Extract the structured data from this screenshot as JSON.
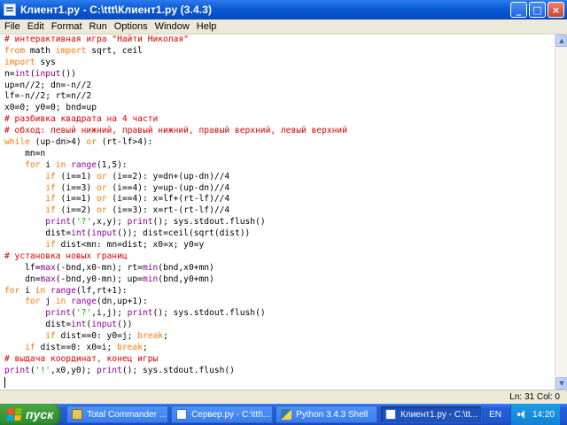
{
  "window": {
    "title": "Клиент1.py - C:\\ttt\\Клиент1.py (3.4.3)",
    "controls": {
      "minimize": "_",
      "maximize": "□",
      "close": "×"
    }
  },
  "menu": [
    "File",
    "Edit",
    "Format",
    "Run",
    "Options",
    "Window",
    "Help"
  ],
  "code_lines": [
    [
      {
        "t": "com",
        "s": "# интерактивная игра \"Найти Николая\""
      }
    ],
    [
      {
        "t": "kw",
        "s": "from"
      },
      {
        "t": "def",
        "s": " math "
      },
      {
        "t": "kw",
        "s": "import"
      },
      {
        "t": "def",
        "s": " sqrt, ceil"
      }
    ],
    [
      {
        "t": "kw",
        "s": "import"
      },
      {
        "t": "def",
        "s": " sys"
      }
    ],
    [
      {
        "t": "def",
        "s": "n="
      },
      {
        "t": "bi",
        "s": "int"
      },
      {
        "t": "def",
        "s": "("
      },
      {
        "t": "bi",
        "s": "input"
      },
      {
        "t": "def",
        "s": "())"
      }
    ],
    [
      {
        "t": "def",
        "s": "up=n//2; dn=-n//2"
      }
    ],
    [
      {
        "t": "def",
        "s": "lf=-n//2; rt=n//2"
      }
    ],
    [
      {
        "t": "def",
        "s": "x0=0; y0=0; bnd=up"
      }
    ],
    [
      {
        "t": "com",
        "s": "# разбивка квадрата на 4 части"
      }
    ],
    [
      {
        "t": "com",
        "s": "# обход: левый нижний, правый нижний, правый верхний, левый верхний"
      }
    ],
    [
      {
        "t": "kw",
        "s": "while"
      },
      {
        "t": "def",
        "s": " (up-dn>4) "
      },
      {
        "t": "kw",
        "s": "or"
      },
      {
        "t": "def",
        "s": " (rt-lf>4):"
      }
    ],
    [
      {
        "t": "def",
        "s": "    mn=n"
      }
    ],
    [
      {
        "t": "def",
        "s": "    "
      },
      {
        "t": "kw",
        "s": "for"
      },
      {
        "t": "def",
        "s": " i "
      },
      {
        "t": "kw",
        "s": "in"
      },
      {
        "t": "def",
        "s": " "
      },
      {
        "t": "bi",
        "s": "range"
      },
      {
        "t": "def",
        "s": "(1,5):"
      }
    ],
    [
      {
        "t": "def",
        "s": "        "
      },
      {
        "t": "kw",
        "s": "if"
      },
      {
        "t": "def",
        "s": " (i==1) "
      },
      {
        "t": "kw",
        "s": "or"
      },
      {
        "t": "def",
        "s": " (i==2): y=dn+(up-dn)//4"
      }
    ],
    [
      {
        "t": "def",
        "s": "        "
      },
      {
        "t": "kw",
        "s": "if"
      },
      {
        "t": "def",
        "s": " (i==3) "
      },
      {
        "t": "kw",
        "s": "or"
      },
      {
        "t": "def",
        "s": " (i==4): y=up-(up-dn)//4"
      }
    ],
    [
      {
        "t": "def",
        "s": "        "
      },
      {
        "t": "kw",
        "s": "if"
      },
      {
        "t": "def",
        "s": " (i==1) "
      },
      {
        "t": "kw",
        "s": "or"
      },
      {
        "t": "def",
        "s": " (i==4): x=lf+(rt-lf)//4"
      }
    ],
    [
      {
        "t": "def",
        "s": "        "
      },
      {
        "t": "kw",
        "s": "if"
      },
      {
        "t": "def",
        "s": " (i==2) "
      },
      {
        "t": "kw",
        "s": "or"
      },
      {
        "t": "def",
        "s": " (i==3): x=rt-(rt-lf)//4"
      }
    ],
    [
      {
        "t": "def",
        "s": "        "
      },
      {
        "t": "bi",
        "s": "print"
      },
      {
        "t": "def",
        "s": "("
      },
      {
        "t": "str",
        "s": "'?'"
      },
      {
        "t": "def",
        "s": ",x,y); "
      },
      {
        "t": "bi",
        "s": "print"
      },
      {
        "t": "def",
        "s": "(); sys.stdout.flush()"
      }
    ],
    [
      {
        "t": "def",
        "s": "        dist="
      },
      {
        "t": "bi",
        "s": "int"
      },
      {
        "t": "def",
        "s": "("
      },
      {
        "t": "bi",
        "s": "input"
      },
      {
        "t": "def",
        "s": "()); dist=ceil(sqrt(dist))"
      }
    ],
    [
      {
        "t": "def",
        "s": "        "
      },
      {
        "t": "kw",
        "s": "if"
      },
      {
        "t": "def",
        "s": " dist<mn: mn=dist; x0=x; y0=y"
      }
    ],
    [
      {
        "t": "com",
        "s": "# установка новых границ"
      }
    ],
    [
      {
        "t": "def",
        "s": "    lf="
      },
      {
        "t": "bi",
        "s": "max"
      },
      {
        "t": "def",
        "s": "(-bnd,x0-mn); rt="
      },
      {
        "t": "bi",
        "s": "min"
      },
      {
        "t": "def",
        "s": "(bnd,x0+mn)"
      }
    ],
    [
      {
        "t": "def",
        "s": "    dn="
      },
      {
        "t": "bi",
        "s": "max"
      },
      {
        "t": "def",
        "s": "(-bnd,y0-mn); up="
      },
      {
        "t": "bi",
        "s": "min"
      },
      {
        "t": "def",
        "s": "(bnd,y0+mn)"
      }
    ],
    [
      {
        "t": "kw",
        "s": "for"
      },
      {
        "t": "def",
        "s": " i "
      },
      {
        "t": "kw",
        "s": "in"
      },
      {
        "t": "def",
        "s": " "
      },
      {
        "t": "bi",
        "s": "range"
      },
      {
        "t": "def",
        "s": "(lf,rt+1):"
      }
    ],
    [
      {
        "t": "def",
        "s": "    "
      },
      {
        "t": "kw",
        "s": "for"
      },
      {
        "t": "def",
        "s": " j "
      },
      {
        "t": "kw",
        "s": "in"
      },
      {
        "t": "def",
        "s": " "
      },
      {
        "t": "bi",
        "s": "range"
      },
      {
        "t": "def",
        "s": "(dn,up+1):"
      }
    ],
    [
      {
        "t": "def",
        "s": "        "
      },
      {
        "t": "bi",
        "s": "print"
      },
      {
        "t": "def",
        "s": "("
      },
      {
        "t": "str",
        "s": "'?'"
      },
      {
        "t": "def",
        "s": ",i,j); "
      },
      {
        "t": "bi",
        "s": "print"
      },
      {
        "t": "def",
        "s": "(); sys.stdout.flush()"
      }
    ],
    [
      {
        "t": "def",
        "s": "        dist="
      },
      {
        "t": "bi",
        "s": "int"
      },
      {
        "t": "def",
        "s": "("
      },
      {
        "t": "bi",
        "s": "input"
      },
      {
        "t": "def",
        "s": "())"
      }
    ],
    [
      {
        "t": "def",
        "s": "        "
      },
      {
        "t": "kw",
        "s": "if"
      },
      {
        "t": "def",
        "s": " dist==0: y0=j; "
      },
      {
        "t": "kw",
        "s": "break"
      },
      {
        "t": "def",
        "s": ";"
      }
    ],
    [
      {
        "t": "def",
        "s": "    "
      },
      {
        "t": "kw",
        "s": "if"
      },
      {
        "t": "def",
        "s": " dist==0: x0=i; "
      },
      {
        "t": "kw",
        "s": "break"
      },
      {
        "t": "def",
        "s": ";"
      }
    ],
    [
      {
        "t": "com",
        "s": "# выдача координат, конец игры"
      }
    ],
    [
      {
        "t": "bi",
        "s": "print"
      },
      {
        "t": "def",
        "s": "("
      },
      {
        "t": "str",
        "s": "'!'"
      },
      {
        "t": "def",
        "s": ",x0,y0); "
      },
      {
        "t": "bi",
        "s": "print"
      },
      {
        "t": "def",
        "s": "(); sys.stdout.flush()"
      }
    ]
  ],
  "status": {
    "position": "Ln: 31 Col: 0"
  },
  "taskbar": {
    "start_label": "пуск",
    "tasks": [
      {
        "label": "Total Commander ...",
        "icon": "total-commander-icon",
        "active": false
      },
      {
        "label": "Сервер.py - C:\\ttt\\...",
        "icon": "python-file-icon",
        "active": false
      },
      {
        "label": "Python 3.4.3 Shell",
        "icon": "python-shell-icon",
        "active": false
      },
      {
        "label": "Клиент1.py - C:\\tt...",
        "icon": "python-file-icon",
        "active": true
      }
    ],
    "lang": "EN",
    "clock": "14:20"
  },
  "colors": {
    "comment": "#dd0000",
    "keyword": "#ff7700",
    "builtin": "#900090",
    "string": "#00aa00",
    "titlebar": "#0a5ad4",
    "taskbar": "#245edb",
    "start": "#3c9a3c"
  }
}
